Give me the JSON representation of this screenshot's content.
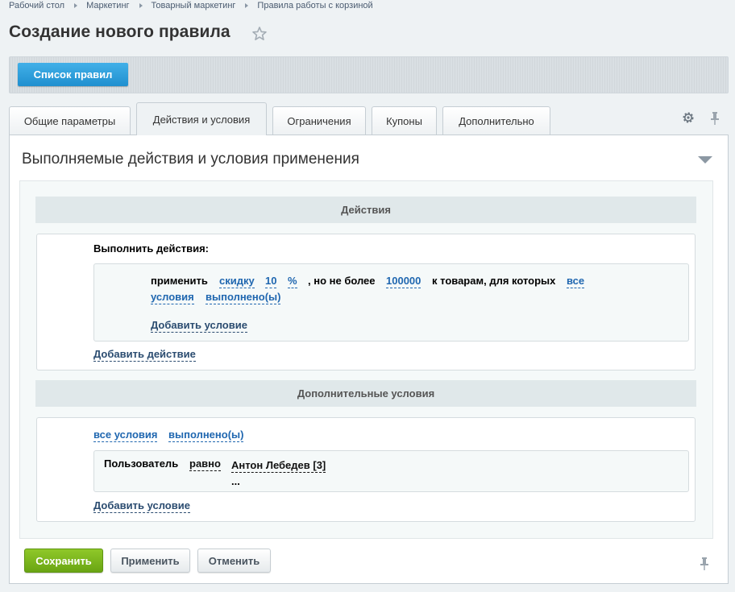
{
  "breadcrumbs": [
    "Рабочий стол",
    "Маркетинг",
    "Товарный маркетинг",
    "Правила работы с корзиной"
  ],
  "page": {
    "title": "Создание нового правила"
  },
  "toolbar": {
    "list_button": "Список правил"
  },
  "tabs": [
    "Общие параметры",
    "Действия и условия",
    "Ограничения",
    "Купоны",
    "Дополнительно"
  ],
  "active_tab": "Действия и условия",
  "section": {
    "title": "Выполняемые действия и условия применения"
  },
  "actions": {
    "header": "Действия",
    "label": "Выполнить действия:",
    "apply": "применить",
    "type": "скидку",
    "value": "10",
    "unit": "%",
    "but_not_more": ", но не более",
    "max": "100000",
    "to_goods": "к товарам, для которых",
    "cond_all_1": "все",
    "cond_all_2": "условия",
    "cond_done": "выполнено(ы)",
    "add_condition": "Добавить условие",
    "add_action": "Добавить действие"
  },
  "extra": {
    "header": "Дополнительные условия",
    "all_conditions": "все условия",
    "done": "выполнено(ы)",
    "user_label": "Пользователь",
    "operator": "равно",
    "user_value": "Антон Лебедев [3]",
    "more": "...",
    "add_condition": "Добавить условие"
  },
  "buttons": {
    "save": "Сохранить",
    "apply": "Применить",
    "cancel": "Отменить"
  },
  "colors": {
    "accent_blue": "#2c9dd9",
    "save_green": "#7ab51d",
    "link": "#2067b0"
  }
}
